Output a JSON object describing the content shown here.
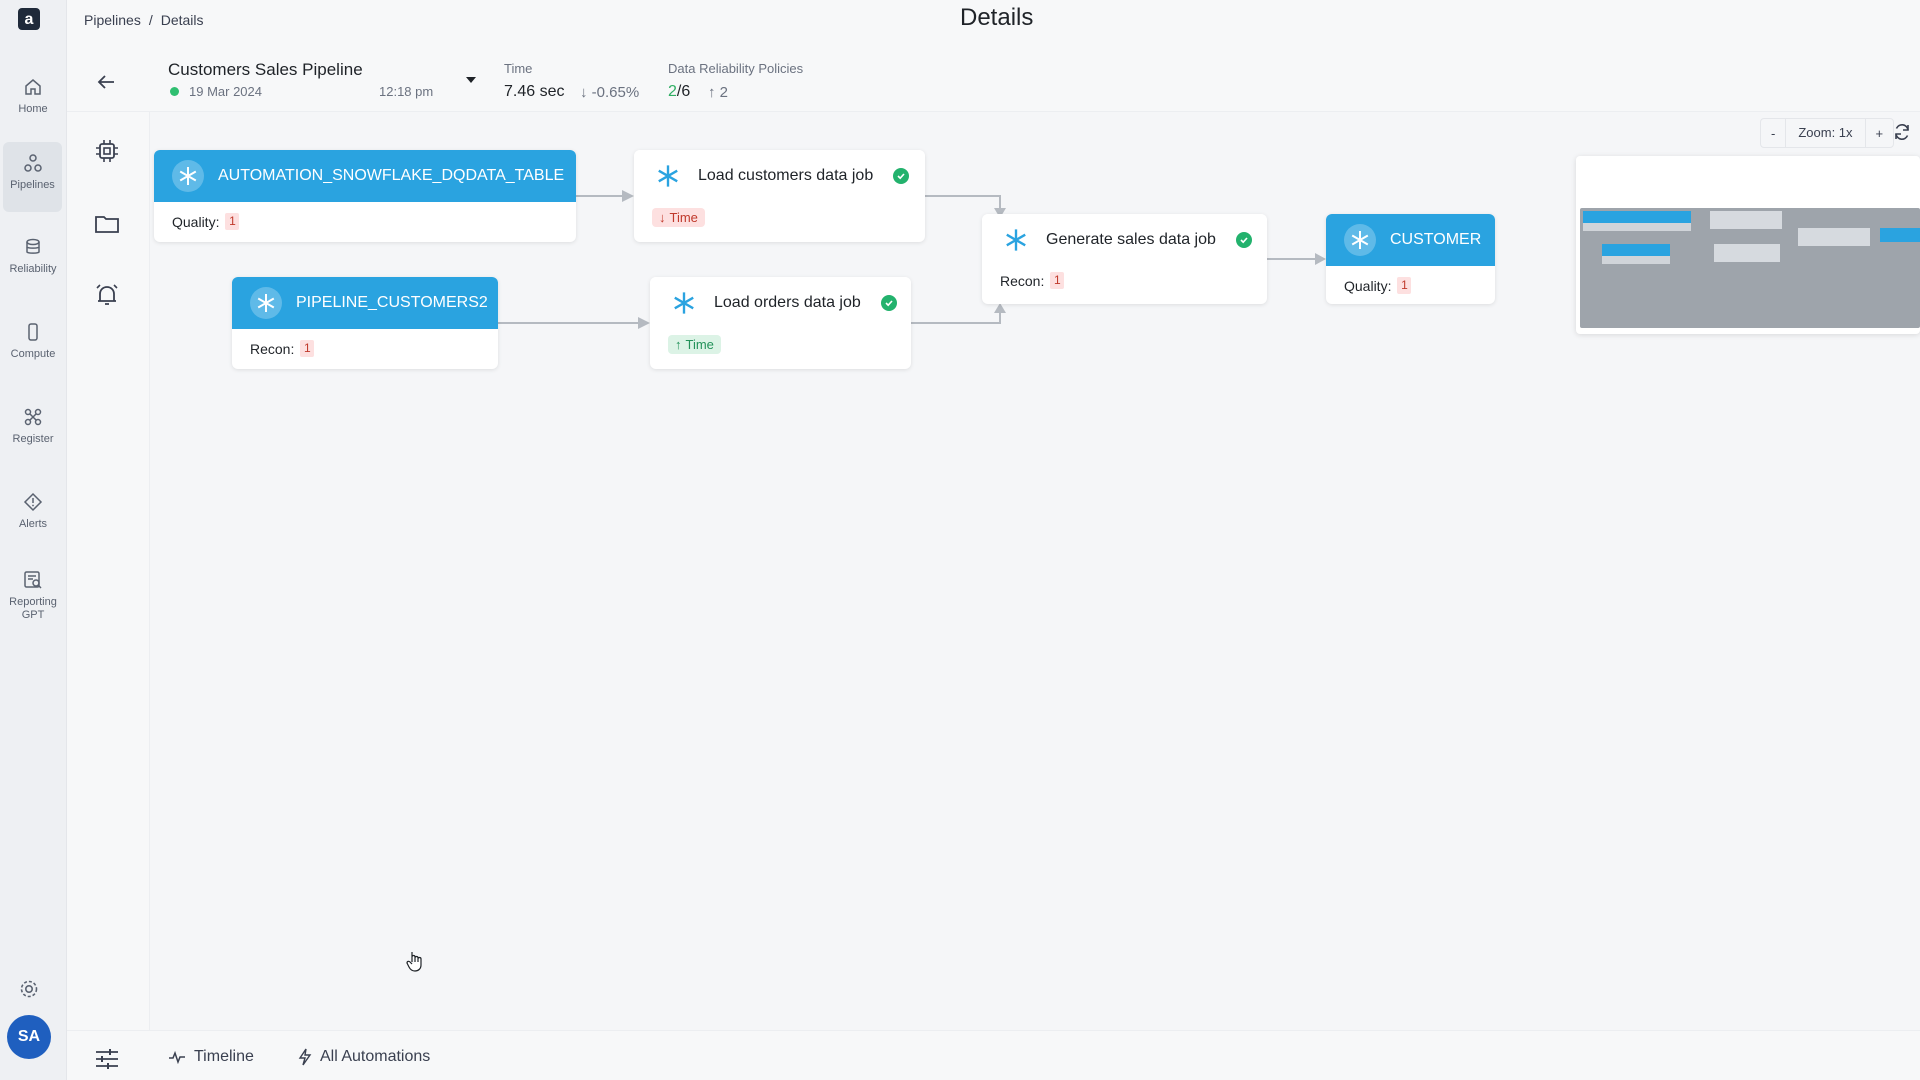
{
  "app": {
    "logo_letter": "a"
  },
  "nav": {
    "items": [
      {
        "label": "Home",
        "icon": "home-icon"
      },
      {
        "label": "Pipelines",
        "icon": "pipelines-icon",
        "active": true
      },
      {
        "label": "Reliability",
        "icon": "database-icon"
      },
      {
        "label": "Compute",
        "icon": "compute-icon"
      },
      {
        "label": "Register",
        "icon": "register-icon"
      },
      {
        "label": "Alerts",
        "icon": "alert-diamond-icon"
      },
      {
        "label": "Reporting GPT",
        "icon": "reporting-icon"
      }
    ],
    "avatar_initials": "SA"
  },
  "breadcrumb": {
    "root": "Pipelines",
    "sep": "/",
    "current": "Details"
  },
  "page_title": "Details",
  "pipeline": {
    "name": "Customers Sales Pipeline",
    "date": "19 Mar 2024",
    "time": "12:18 pm",
    "status_color": "#2fbf71"
  },
  "metrics": {
    "time_label": "Time",
    "time_value": "7.46 sec",
    "time_delta": "↓ -0.65%",
    "drp_label": "Data Reliability Policies",
    "drp_pass": "2",
    "drp_total": "/6",
    "drp_change": "↑ 2"
  },
  "canvas": {
    "zoom_minus": "-",
    "zoom_label": "Zoom: 1x",
    "zoom_plus": "+"
  },
  "nodes": {
    "automation": {
      "title": "AUTOMATION_SNOWFLAKE_DQDATA_TABLE",
      "metric_label": "Quality:",
      "metric_value": "1"
    },
    "pipeline_customers2": {
      "title": "PIPELINE_CUSTOMERS2",
      "metric_label": "Recon:",
      "metric_value": "1"
    },
    "load_customers": {
      "title": "Load customers data job",
      "pill": "Time"
    },
    "load_orders": {
      "title": "Load orders data job",
      "pill": "Time"
    },
    "generate_sales": {
      "title": "Generate sales data job",
      "metric_label": "Recon:",
      "metric_value": "1"
    },
    "customer": {
      "title": "CUSTOMER",
      "metric_label": "Quality:",
      "metric_value": "1"
    }
  },
  "colors": {
    "accent": "#2aa3e0",
    "success": "#23b26d",
    "danger": "#c0392b"
  },
  "bottom": {
    "timeline_label": "Timeline",
    "automations_label": "All Automations"
  }
}
